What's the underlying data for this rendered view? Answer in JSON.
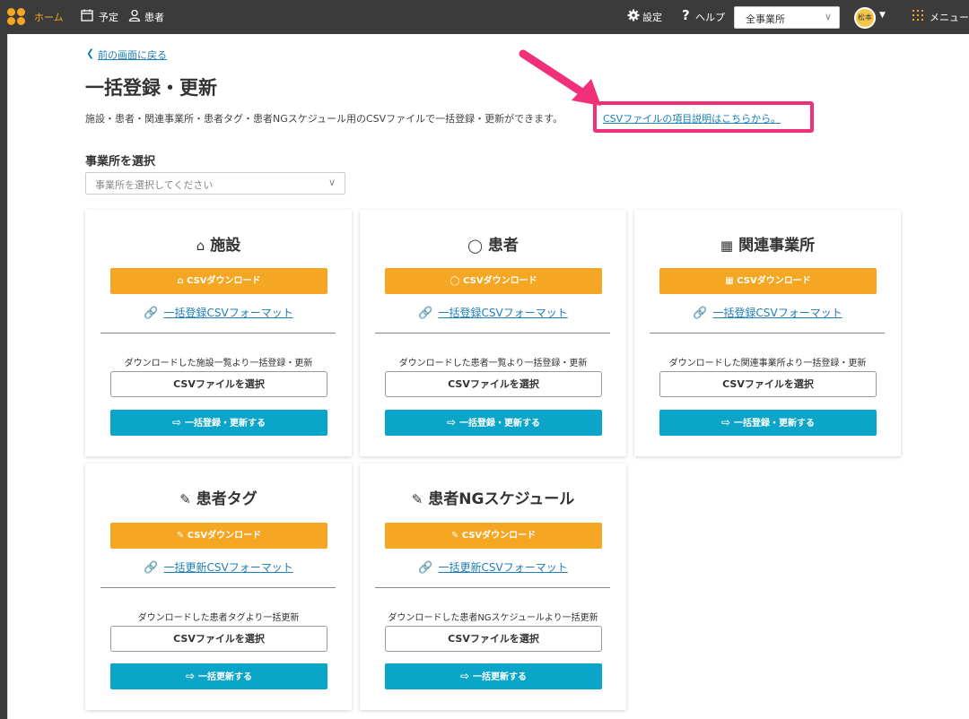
{
  "topbar": {
    "home": "ホーム",
    "schedule": "予定",
    "patients": "患者",
    "settings": "設定",
    "help": "ヘルプ",
    "office_select": "全事業所",
    "avatar": "松本",
    "menu": "メニュー"
  },
  "back_link": "前の画面に戻る",
  "page_title": "一括登録・更新",
  "description": "施設・患者・関連事業所・患者タグ・患者NGスケジュール用のCSVファイルで一括登録・更新ができます。",
  "description_link": "CSVファイルの項目説明はこちらから。",
  "office_section": {
    "label": "事業所を選択",
    "placeholder": "事業所を選択してください"
  },
  "cards": [
    {
      "title": "施設",
      "icon": "home-icon",
      "download": "CSVダウンロード",
      "format_link": "一括登録CSVフォーマット",
      "hint": "ダウンロードした施設一覧より一括登録・更新",
      "select_file": "CSVファイルを選択",
      "submit": "一括登録・更新する"
    },
    {
      "title": "患者",
      "icon": "person-icon",
      "download": "CSVダウンロード",
      "format_link": "一括登録CSVフォーマット",
      "hint": "ダウンロードした患者一覧より一括登録・更新",
      "select_file": "CSVファイルを選択",
      "submit": "一括登録・更新する"
    },
    {
      "title": "関連事業所",
      "icon": "building-icon",
      "download": "CSVダウンロード",
      "format_link": "一括登録CSVフォーマット",
      "hint": "ダウンロードした関連事業所より一括登録・更新",
      "select_file": "CSVファイルを選択",
      "submit": "一括登録・更新する"
    },
    {
      "title": "患者タグ",
      "icon": "tag-edit-icon",
      "download": "CSVダウンロード",
      "format_link": "一括更新CSVフォーマット",
      "hint": "ダウンロードした患者タグより一括更新",
      "select_file": "CSVファイルを選択",
      "submit": "一括更新する"
    },
    {
      "title": "患者NGスケジュール",
      "icon": "schedule-edit-icon",
      "download": "CSVダウンロード",
      "format_link": "一括更新CSVフォーマット",
      "hint": "ダウンロードした患者NGスケジュールより一括更新",
      "select_file": "CSVファイルを選択",
      "submit": "一括更新する"
    }
  ],
  "colors": {
    "topbar": "#3b3b3b",
    "download_button": "#f5a623",
    "submit_button": "#0aa5c8",
    "link": "#1d7fb8",
    "highlight": "#f0317a"
  }
}
